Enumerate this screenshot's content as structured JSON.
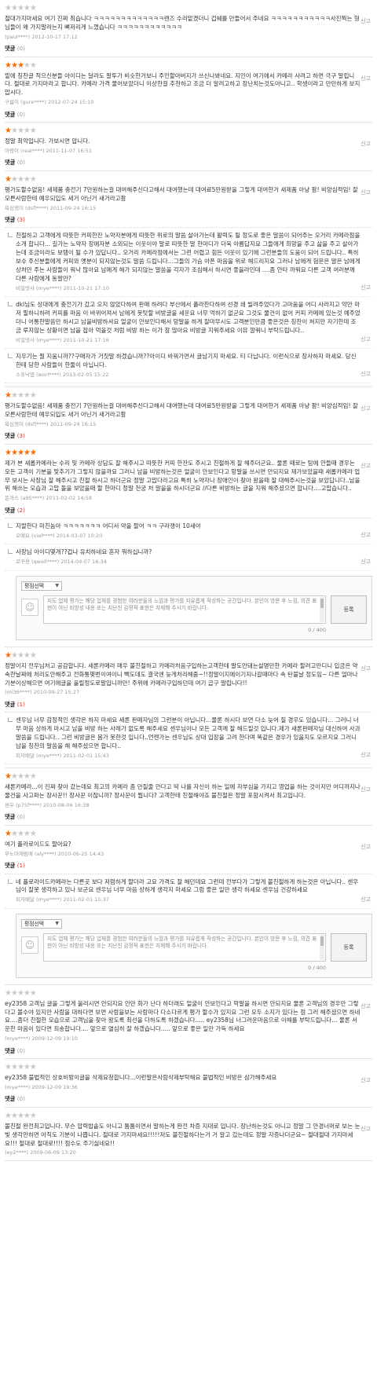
{
  "labels": {
    "report": "신고",
    "reply": "댓글"
  },
  "editor": {
    "select_label": "평점선택",
    "placeholder": "지도 업체 평가는 해당 업체를 경험한 여러분들의 느낌과 평가를 자유롭게 작성하는 공간입니다. 본인이 방문 후 느낌, 의견 표현이 아닌 비방성 내용 또는 지난친 감정적 표현은 자제해 주시기 바랍니다.",
    "submit_label": "등록",
    "counter": "0 / 400"
  },
  "reviews": [
    {
      "rating": 0,
      "body": "절대가지마세요 여기 진짜 최습니다 ㅋㅋㅋㅋㅋㅋㅋㅋㅋㅋㅋㅋㅋ렌즈 수리맡겼더니 겁쉐를 만들어서 주네요 ㅋㅋㅋㅋㅋㅋㅋㅋㅋㅋㅋ사진찍는 형님들이 왜 가지말라는지 뼈저리게 느꼈습니다 ㅋㅋㅋㅋㅋㅋㅋㅋㅋㅋㅋㅋ",
      "author": "(paul****)",
      "date": "2012-10-17 17:12",
      "reply_count": "(0)",
      "replies": []
    },
    {
      "rating": 3,
      "body": "밑에 칭찬글 적으신분들 아이디는 달라도 말투가 비슷한거보니 주인할아버지가 쓰신나봐네요. 지인이 여기에서 카메라 사려고 하면 극구 말립니다. 절대로 가지마라고 합니다. 카메라 가격 물어보았더니 이상한걸 추천하고 조금 더 알려고하고 장난치는것도아니고.. 학생이라고 만만하게 보지맙시다.",
      "author": "구름이 (gure****)",
      "date": "2012-07-24 15:10",
      "reply_count": "(0)",
      "replies": []
    },
    {
      "rating": 1,
      "body": "정말 최악입니다. 가보시면 압니다.",
      "author": "아랑이 (real****)",
      "date": "2011-11-07 16:51",
      "reply_count": "(0)",
      "replies": []
    },
    {
      "rating": 1,
      "body": "평가도할수없음! 새제품 충전기 7만원하는걸 대여해주신다고해서 대여했는데 대여료5만원받을 그렇게 대여한거 새제품 아냥 팜! 비양심적임! 잘모른사람한테 예우되입도 새거 아닌거 새거라고팜",
      "author": "욕심쟁이 (dsfl****)",
      "date": "2011-09-24 16:15",
      "reply_count": "(3)",
      "replies": [
        {
          "body": "친절하고 고객에게 따뜻한 커피한잔 노약자분에게 따뜻한 위로의 말씀 살아가는데 활력도 될 정도로 좋은 말씀이 되어주는 오거리 카메라점을 소개 합니다... 길가는 노약자 장애자분 소외되는 이웃이야 말로 따뜻한 말 한마디가 더욱 아름답지요 그들에게 희망을 주고 삶을 주고 살아가는데 조금이라도 보탬이 될 수가 있답니다.. 오거리 카메라점에서는 그런 어렵고 힘든 이웃이 있기에 그런분들의 도움이 되어 드립니다.. 특히 보수 주신분들에게 커피와 옛분이 되지않는것도 말씀 드립니다...그들의 가슴 아픈 마음을 위로 해드리지요 그러나 남에게 험문은 말은 남에게 상처만 주는 사람들이 워낙 많아요 남에게 해가 되지않는 말씀을 각자가 조심해서 하시면 좋을라인데 ....좀 안타 까워요 다른 고객 여러분께 다른 사람에게 동말만?",
          "author": "비밀댓사 (mye****)",
          "date": "2011-10-21 17:10"
        },
        {
          "body": "dkl님도 상대에게 충전기가 갔고 오지 않았다하여 판매 하려다 부산에서 폴라찬다하여 선경 쇄 빌려주었다가 고마움을 어디 사라지고 악만 마저 필하니하려 커피를 마음 이 바뀌어져서 남에게 못탓할 비방글을 세운요 너무 억하기 없군요 그것도 물건이 없어 커피 카메에 있는것 예주었더니 어통한말씀만 하시고 남을비방하셔요 얼굴이 안보인다해서 망말을 하게 잘마무시도 고객분인만큼 좋은것은 칭찬이 쳐지만 자기한데 조금 루지않는 상황이면 남을 잡아 먹을것 처럼 비방 하는 이가 참 많아요 비방글 지워주세요 이뮤 깔쿼니 부탁드립니다..",
          "author": "비밀댓사 (mye****)",
          "date": "2011-10-21 17:16"
        },
        {
          "body": "지우기는 뭘 지움니까??구매자가 거짓말 하겠습니까??아이디 바꿔가면서 글남기지 마세요. 티 다납니다. 이런식으로 장사하지 마세요. 당신한테 당한 사람들이 한둘이 아닙니다.",
          "author": "소휴낙엽 (worl****)",
          "date": "2013-02-05 15:22"
        }
      ]
    },
    {
      "rating": 1,
      "body": "평가도할수없음! 새제품 충전기 7만원하는걸 대여해주신다고해서 대여했는데 대여료5만원받을 그렇게 대여한거 새제품 아냥 팜! 비양심적임! 잘모른사람한테 예우되입도 새거 아닌거 새거라고팜",
      "author": "욕심쟁이 (dsfl****)",
      "date": "2011-09-24 16:15",
      "reply_count": "(3)",
      "replies": []
    },
    {
      "rating": 5,
      "body": "제가 본 새롭카메라는 수리 및 카메라 상담도 잘 해주시고 따뜻한 커피 한잔도 주시고 친절하게 잘 해주더군요.. 물론 때로는 탐에 안들때 경우는 모든 고객이 기분을 맞추기가 그렇지 않을까요 그러니 남을 비방하는것은 얼굴이 안보인다고 망말을 쓰시면 안되지요 제가보았을때 새롭카메라 업무 보시는 사장님 잘 해주시고 친절 하시고 하더군요 정말 고맙다라고요 특히 노약자나 장애인이 찾아 왔을때 잘 대해주시는것을 보았답니다..남을 위 해쓰는 모습과 고맙 돌을 보았을때 할 한마디 정말 천궁 처 말을을 하시더군요 //다른 비방하는 글을 지워 해주셨으면 합니다....고맙습니다..",
      "author": "돈까스 (a95****)",
      "date": "2011-02-02 14:58",
      "reply_count": "(2)",
      "replies": [
        {
          "body": "지랄한다 미친놈아 ㅋㅋㅋㅋㅋㅋㅋ 어디서 약을 팔어 ㅋㅋ 구라쟁이 10새야",
          "author": "오예요 (viel****)",
          "date": "2014-03-07 10:20"
        },
        {
          "body": "사장님 아이디몇개??겁나 유치하네요 혼자 뭐하십니까?",
          "author": "로꾸용 (qwell****)",
          "date": "2014-04-07 16:34"
        }
      ],
      "editor": true
    },
    {
      "rating": 1,
      "body": "정말이지 전우님처고 공감합니다. 새론카메라 매우 불친절하고 카메라처음구입하는고객한테 말도안돼는설명만한 카메라 팔려고만디니 입금은 약속한날짜에 처리도안해주고 전화통몇번이여이니 빽도데도 결국엔 늦게처리해줌~!!정말이지에이기지나갈때마다 속 탄불날 정도임~ 다른 얼마나 기분이상해으면 여기에글을 올릴정도로말입니까만! 주위에 카메라구입하던데 여기 급구 말립니다!!",
      "author": "(mi36****)",
      "date": "2010-09-27 15:27",
      "reply_count": "(1)",
      "replies": [
        {
          "body": "센우님 너무 감정적인 생각은 하지 마세요 새론 판매자님의 그런분이 아닙니다...물론 하시다 보면 다소 늦어 질 경우도 있습니다... 그러니 너무 마음 상하게 마시고 남을 비방 하는 사례가 없도록 해주세요 센우님이나 모든 고객께 잘 해드릴것 입니다.제가 새론판매자님 대신하여 사과 말씀을 드립니다.. 그런 비방글은 몸가 못한것 입니다..언젠가는 센우님도 상대 입장을 고려 한다며 똑같은 경우가 있을지도 모르지요 그러니 남을 칭찬의 말씀을 해 해주셨으면 합니다..",
          "author": "피자배달 (mye****)",
          "date": "2011-02-01 15:43"
        }
      ]
    },
    {
      "rating": 1,
      "body": "새론카메라...이 진짜 찾아 갔는데요 최고의 카메라 좀 만질줄 안다고 딱 나를 자신이 하는 일에 자부심을 가지고 영업을 하는 것이지만 어디까지나 물건을 사고파는 장사꾼!! 장사꾼 이잖니까? 장사꾼이 뭡니다? 고객한테 친절해야죠 불친절은 정말 포함시켜서 최고입니다.",
      "author": "센우 (p75f****)",
      "date": "2010-08-06 16:38",
      "reply_count": "(0)",
      "replies": []
    },
    {
      "rating": 1,
      "body": "여기 플라로이드도 팔아요?",
      "author": "무노아재림애 (aly****)",
      "date": "2010-06-25 14:43",
      "reply_count": "(1)",
      "replies": [
        {
          "body": "네 플로라이드카메라는 다른곳 보다 저렴하게 팔더라 고요 가격도 잘 해던데요 그런데 전부다가 그렇게 불친절하게 하는것은 아닙니다.. 센우님이 잘못 생각하고 있나 보군요 센우님 너무 마음 상하게 생각지 마세요 그럼 좋은 일만 생각 하세요 센우님 건강하세요",
          "author": "피자배달 (mye****)",
          "date": "2011-02-01 15:37"
        }
      ],
      "editor": true
    },
    {
      "rating": 0,
      "body": "ey2358 고객님 글을 그렇게 올리시면 안되지요 안만 화가 난다 하더래도 얼굴이 안보인다고 막말을 하시면 안되지요 물론 고객님의 경우만 그렇다고 볼수야 있지만 사람을 대하다면 보면 사람을보는 사람마다 다소다르게 평가 할수가 있지요 그런 모두 소지가 있다는 점 그러 해주셨으면 하네요....좀더 친절한 모습으로 고객님을 찾아 왔도록 최선을 다하도록 하겠습니다..... ey2358님 너그러운마음으로 이해를 부탁드립니다... 물론 서운한 마음이 있다면 죄송합니다.... 앞으로 열심히 잘 하겠습니다..... 앞으로 좋은 일만 가득 하세요",
      "author": "(mye****)",
      "date": "2009-12-09 19:10",
      "reply_count": "(0)",
      "replies": []
    },
    {
      "rating": 0,
      "body": "ey2358 불법적인 상호비방이글을 삭제요청합니다...이런말은사람삭제부탁해요 불법적인 비방은 삼가해주세요",
      "author": "(mye****)",
      "date": "2009-12-09 19:36",
      "reply_count": "(0)",
      "replies": []
    },
    {
      "rating": 0,
      "body": "불친절 완전최고입니다. 무슨 압력밥솥도 아니고 툼툼이면서 말하는게 완전 차증 지대로 입니다. 장난하는것도 아니고 정말 그 안경너머로 보는 눈빛 생각만하면 아직도 기분이 나쁩니다. 절대로 가지마세요!!!!!저도 불친절하다는거 거 알고 갔는데도 정말 자증나더군요~ 절대절대 가지마세요!!! 절대로 절대로!!!! 점수도 주기싫네요!!",
      "author": "(ey2****)",
      "date": "2009-06-09 13:20",
      "reply_count": "",
      "replies": []
    }
  ]
}
